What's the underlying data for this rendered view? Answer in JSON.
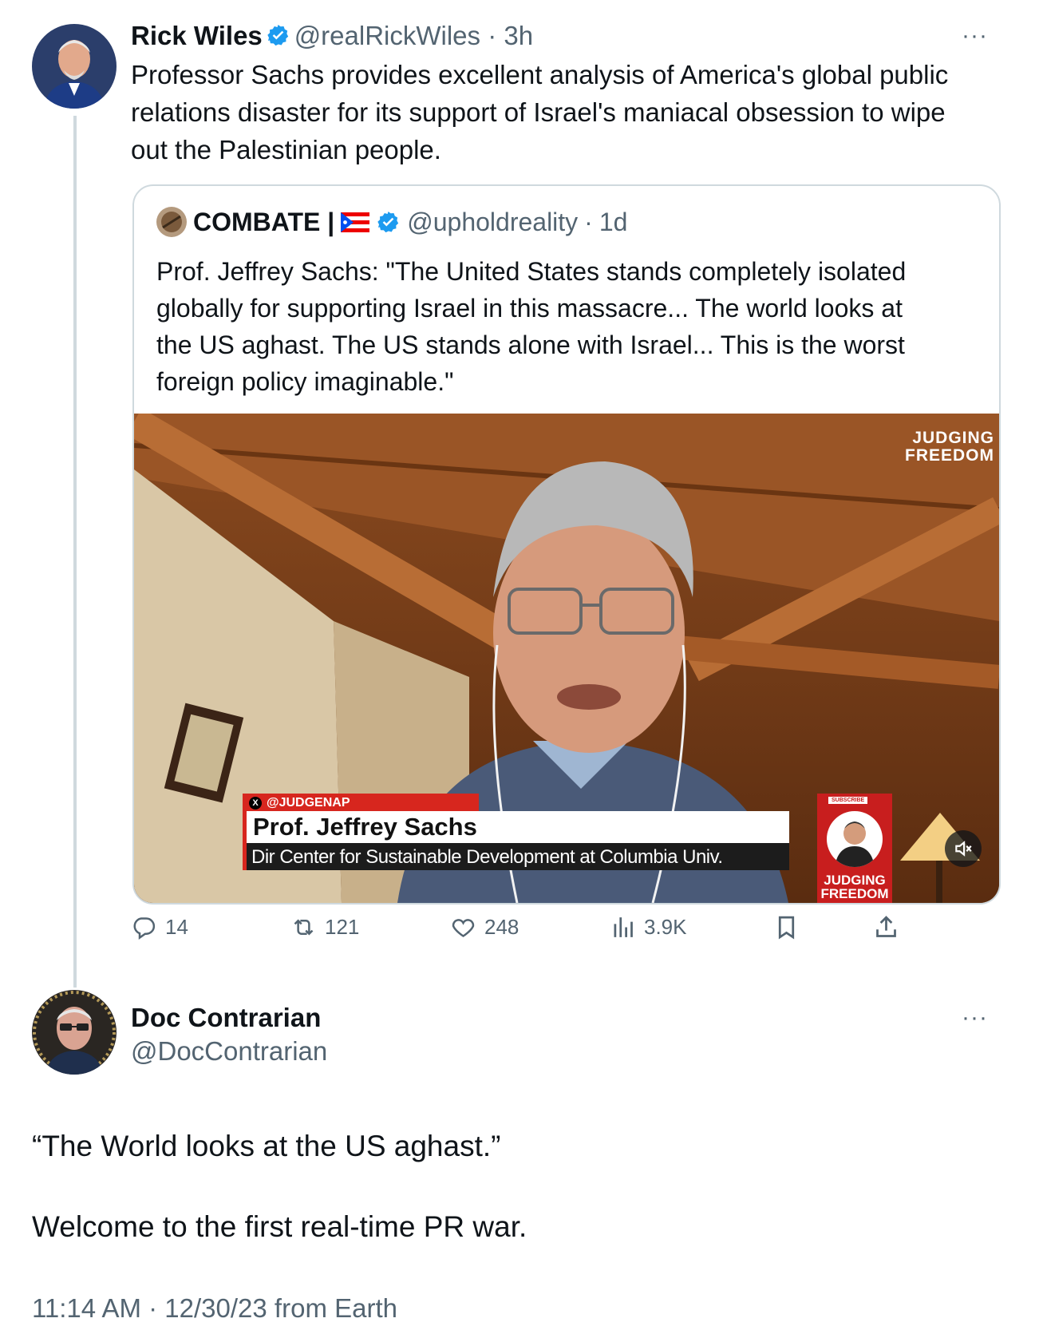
{
  "post": {
    "author_name": "Rick Wiles",
    "author_handle": "@realRickWiles",
    "time": "3h",
    "text_lines": [
      "Professor Sachs provides excellent analysis of America's global public",
      "relations disaster for its support of Israel's maniacal obsession to wipe",
      "out the Palestinian people."
    ],
    "more_label": "···",
    "quote": {
      "author_name": "COMBATE |",
      "author_handle": "@upholdreality",
      "time": "1d",
      "text_lines": [
        "Prof. Jeffrey Sachs: \"The United States stands completely isolated",
        "globally for supporting Israel in this massacre... The world looks at",
        "the US aghast. The US stands alone with Israel... This is the worst",
        "foreign policy imaginable.\""
      ],
      "video": {
        "watermark_line1": "JUDGING",
        "watermark_line2": "FREEDOM",
        "tag": "@JUDGENAP",
        "lower_name": "Prof. Jeffrey Sachs",
        "lower_title": "Dir Center for Sustainable Development at Columbia Univ.",
        "subscribe": "SUBSCRIBE",
        "badge_line1": "JUDGING",
        "badge_line2": "FREEDOM"
      }
    },
    "actions": {
      "replies": "14",
      "reposts": "121",
      "likes": "248",
      "views": "3.9K"
    }
  },
  "reply": {
    "author_name": "Doc Contrarian",
    "author_handle": "@DocContrarian",
    "more_label": "···",
    "paragraph1": "“The World looks at the US aghast.”",
    "paragraph2": "Welcome to the first real-time PR war.",
    "timestamp": "11:14 AM · 12/30/23 from Earth"
  },
  "colors": {
    "verified": "#1d9bf0",
    "secondary_text": "#536471",
    "border": "#cfd9de",
    "accent_red": "#d7261e"
  },
  "icons": {
    "verified": "verified-badge-icon",
    "reply": "speech-bubble-icon",
    "repost": "repost-arrows-icon",
    "like": "heart-icon",
    "views": "bar-chart-icon",
    "bookmark": "bookmark-icon",
    "share": "share-upload-icon",
    "mute": "speaker-muted-icon"
  }
}
